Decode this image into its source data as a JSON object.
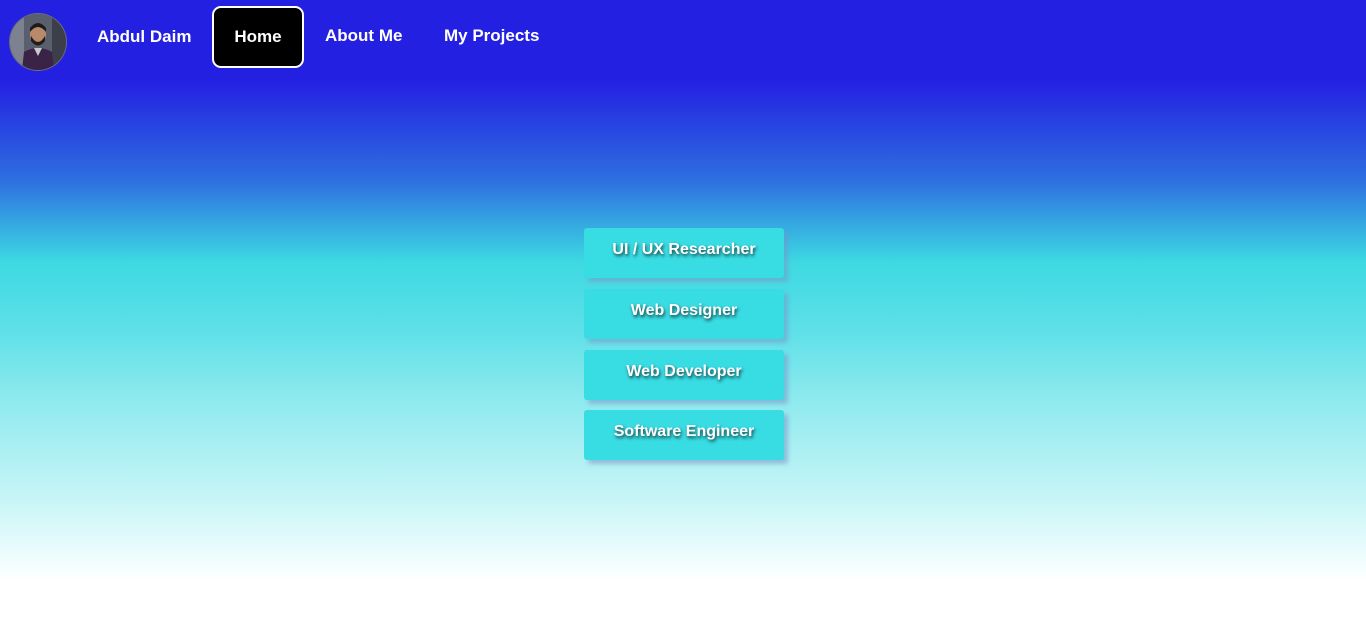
{
  "nav": {
    "brand": "Abdul Daim",
    "links": [
      {
        "label": "Home",
        "active": true
      },
      {
        "label": "About Me"
      },
      {
        "label": "My Projects"
      }
    ],
    "avatar_icon": "profile-photo",
    "bg_color": "#2420e2",
    "active_bg_color": "#000000"
  },
  "roles": [
    {
      "label": "UI / UX Researcher"
    },
    {
      "label": "Web Designer"
    },
    {
      "label": "Web Developer"
    },
    {
      "label": "Software Engineer"
    }
  ],
  "colors": {
    "card": "#38dce3",
    "gradient_top": "#2420e2",
    "gradient_mid": "#3dd9e2",
    "gradient_bottom": "#ffffff"
  }
}
